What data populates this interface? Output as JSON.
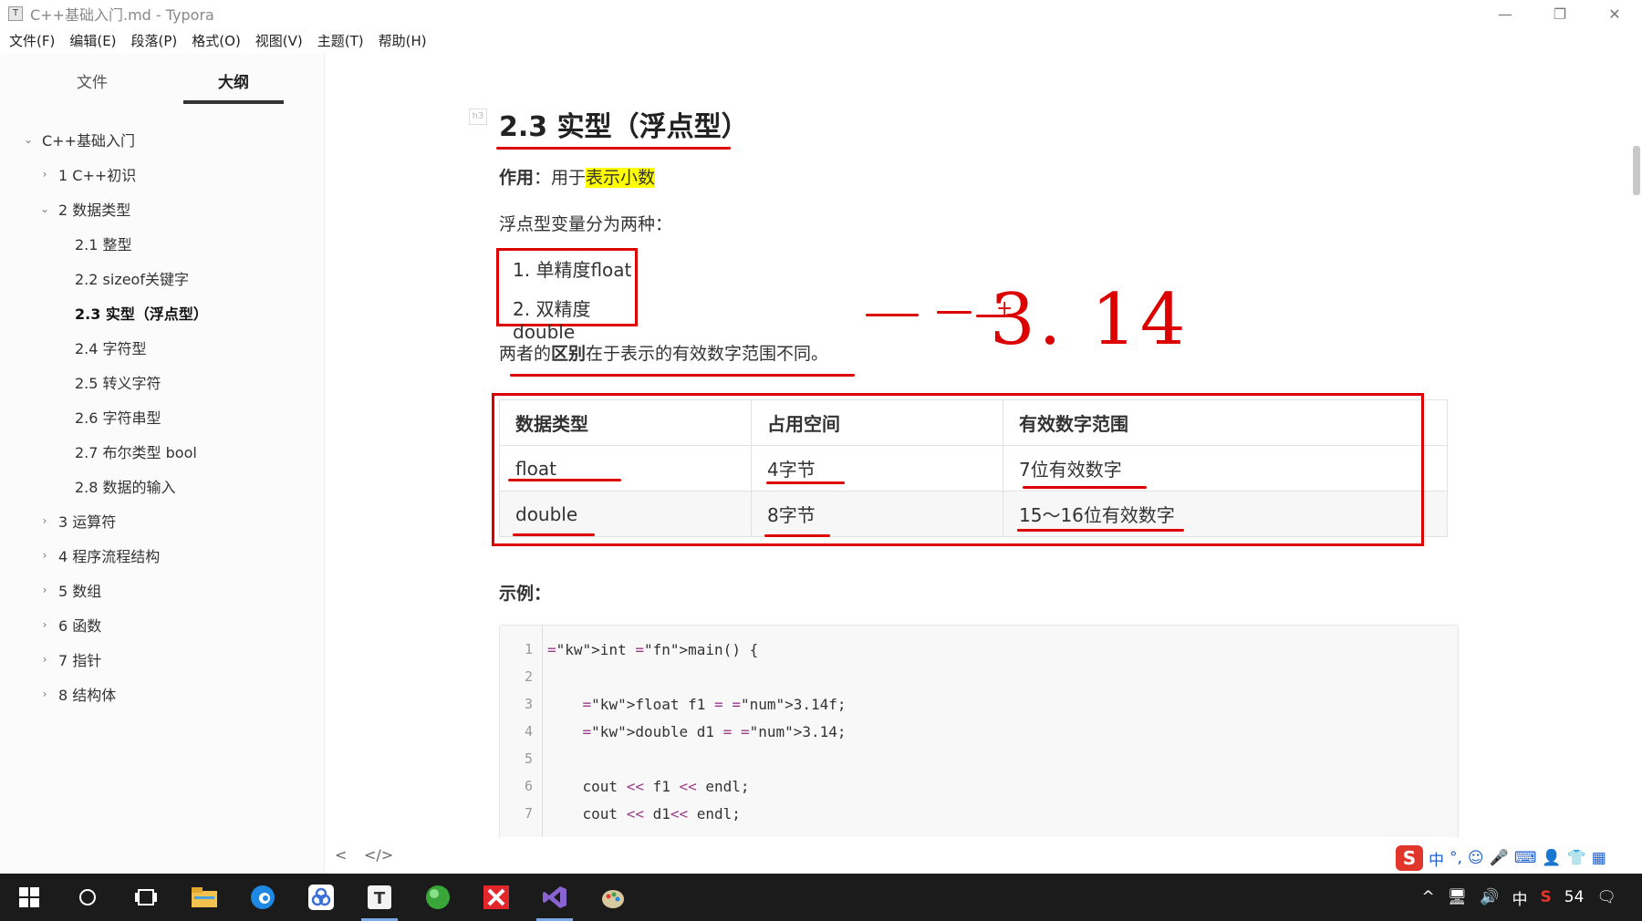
{
  "window": {
    "title": "C++基础入门.md - Typora",
    "app_icon": "T",
    "controls": [
      "—",
      "❐",
      "✕"
    ]
  },
  "menu": [
    "文件(F)",
    "编辑(E)",
    "段落(P)",
    "格式(O)",
    "视图(V)",
    "主题(T)",
    "帮助(H)"
  ],
  "sidebar": {
    "tabs": [
      "文件",
      "大纲"
    ],
    "active_tab": "大纲",
    "outline": [
      {
        "label": "C++基础入门",
        "level": 0,
        "chevron": "⌄"
      },
      {
        "label": "1 C++初识",
        "level": 1,
        "chevron": "›"
      },
      {
        "label": "2 数据类型",
        "level": 1,
        "chevron": "⌄"
      },
      {
        "label": "2.1 整型",
        "level": 2,
        "chevron": ""
      },
      {
        "label": "2.2 sizeof关键字",
        "level": 2,
        "chevron": ""
      },
      {
        "label": "2.3 实型（浮点型）",
        "level": 2,
        "chevron": "",
        "active": true
      },
      {
        "label": "2.4 字符型",
        "level": 2,
        "chevron": ""
      },
      {
        "label": "2.5 转义字符",
        "level": 2,
        "chevron": ""
      },
      {
        "label": "2.6 字符串型",
        "level": 2,
        "chevron": ""
      },
      {
        "label": "2.7 布尔类型 bool",
        "level": 2,
        "chevron": ""
      },
      {
        "label": "2.8 数据的输入",
        "level": 2,
        "chevron": ""
      },
      {
        "label": "3 运算符",
        "level": 1,
        "chevron": "›"
      },
      {
        "label": "4 程序流程结构",
        "level": 1,
        "chevron": "›"
      },
      {
        "label": "5 数组",
        "level": 1,
        "chevron": "›"
      },
      {
        "label": "6 函数",
        "level": 1,
        "chevron": "›"
      },
      {
        "label": "7 指针",
        "level": 1,
        "chevron": "›"
      },
      {
        "label": "8 结构体",
        "level": 1,
        "chevron": "›"
      }
    ]
  },
  "doc": {
    "heading_marker": "h3",
    "heading": "2.3 实型（浮点型）",
    "usage_label": "作用",
    "usage_sep": "：用于",
    "usage_highlight": "表示小数",
    "two_kinds": "浮点型变量分为两种：",
    "list": [
      "1. 单精度float",
      "2. 双精度double"
    ],
    "diff_prefix": "两者的",
    "diff_bold": "区别",
    "diff_suffix": "在于表示的有效数字范围不同。",
    "annotation": "3. 14",
    "annotation_plus": "+",
    "table": {
      "headers": [
        "数据类型",
        "占用空间",
        "有效数字范围"
      ],
      "rows": [
        [
          "float",
          "4字节",
          "7位有效数字"
        ],
        [
          "double",
          "8字节",
          "15～16位有效数字"
        ]
      ]
    },
    "example_label": "示例：",
    "code_lines": [
      {
        "n": "1",
        "code": "int main() {"
      },
      {
        "n": "2",
        "code": ""
      },
      {
        "n": "3",
        "code": "    float f1 = 3.14f;"
      },
      {
        "n": "4",
        "code": "    double d1 = 3.14;"
      },
      {
        "n": "5",
        "code": ""
      },
      {
        "n": "6",
        "code": "    cout << f1 << endl;"
      },
      {
        "n": "7",
        "code": "    cout << d1<< endl;"
      }
    ]
  },
  "statusbar": {
    "toggle_sidebar": "<",
    "source_mode": "</>"
  },
  "ime": {
    "logo": "S",
    "items": [
      "中",
      "°,",
      "☺",
      "🎤",
      "⌨",
      "👤",
      "👕",
      "▦"
    ]
  },
  "taskbar": {
    "icons": [
      "start-icon",
      "search-icon",
      "task-view-icon",
      "file-explorer-icon",
      "edge-icon",
      "app-icon",
      "typora-icon",
      "app-green-icon",
      "xmind-icon",
      "visual-studio-icon",
      "paint-icon"
    ],
    "tray": [
      "^",
      "🖥",
      "🔊",
      "中",
      "S",
      "54",
      "🗨"
    ]
  },
  "colors": {
    "annotation_red": "#dd0000",
    "highlight_yellow": "#ffff00",
    "taskbar": "#1b1b1b"
  }
}
